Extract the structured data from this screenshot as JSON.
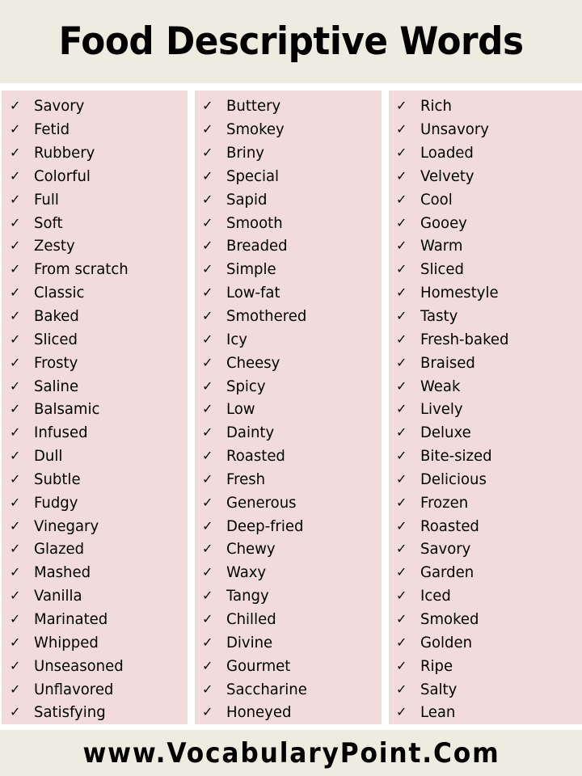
{
  "header": {
    "title": "Food Descriptive Words"
  },
  "icons": {
    "bullet": "check-mark-icon",
    "glyph": "✓"
  },
  "colors": {
    "header_bg": "#eeebe1",
    "panel_bg": "#f2dcdb",
    "text": "#000000"
  },
  "columns": [
    {
      "words": [
        "Savory",
        "Fetid",
        "Rubbery",
        "Colorful",
        "Full",
        "Soft",
        "Zesty",
        "From scratch",
        "Classic",
        "Baked",
        "Sliced",
        "Frosty",
        "Saline",
        "Balsamic",
        "Infused",
        "Dull",
        "Subtle",
        "Fudgy",
        "Vinegary",
        "Glazed",
        "Mashed",
        "Vanilla",
        "Marinated",
        "Whipped",
        "Unseasoned",
        "Unflavored",
        "Satisfying"
      ]
    },
    {
      "words": [
        "Buttery",
        "Smokey",
        "Briny",
        "Special",
        "Sapid",
        "Smooth",
        "Breaded",
        "Simple",
        "Low-fat",
        "Smothered",
        "Icy",
        "Cheesy",
        "Spicy",
        "Low",
        "Dainty",
        "Roasted",
        "Fresh",
        "Generous",
        "Deep-fried",
        "Chewy",
        "Waxy",
        "Tangy",
        "Chilled",
        "Divine",
        "Gourmet",
        "Saccharine",
        "Honeyed"
      ]
    },
    {
      "words": [
        "Rich",
        "Unsavory",
        "Loaded",
        "Velvety",
        "Cool",
        "Gooey",
        "Warm",
        "Sliced",
        "Homestyle",
        "Tasty",
        "Fresh-baked",
        "Braised",
        "Weak",
        "Lively",
        "Deluxe",
        "Bite-sized",
        "Delicious",
        "Frozen",
        "Roasted",
        "Savory",
        "Garden",
        "Iced",
        "Smoked",
        "Golden",
        "Ripe",
        "Salty",
        "Lean"
      ]
    }
  ],
  "footer": {
    "website": "www.VocabularyPoint.Com"
  }
}
